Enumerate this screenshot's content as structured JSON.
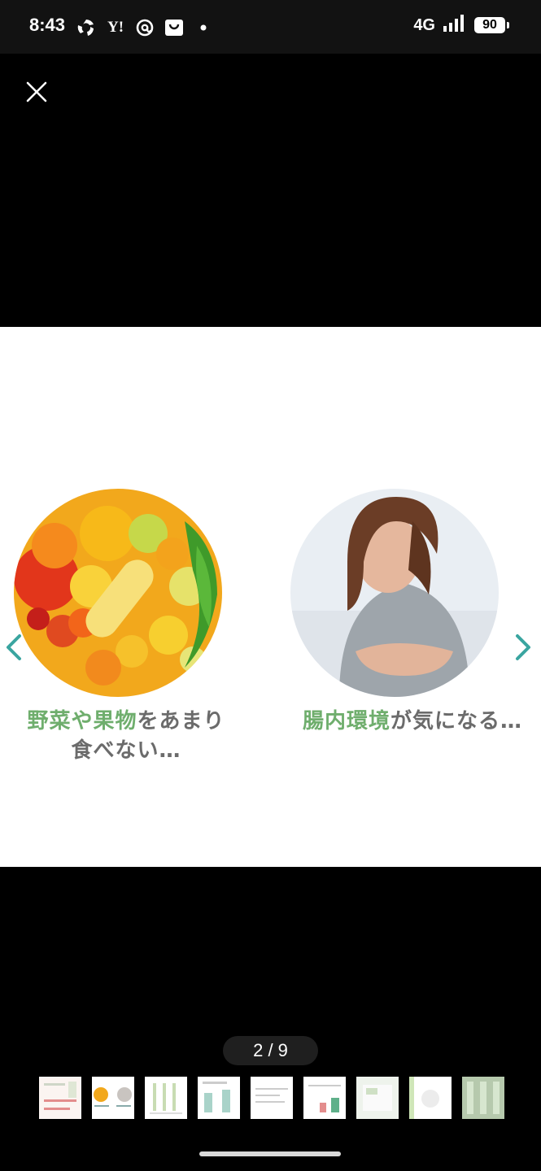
{
  "status_bar": {
    "time": "8:43",
    "icons": [
      "sync-icon",
      "yahoo-icon",
      "threads-icon",
      "shopping-bag-icon",
      "dot-icon"
    ],
    "yahoo_label": "Y!",
    "network": "4G",
    "battery": "90"
  },
  "viewer": {
    "close_icon": "close-icon",
    "counter": "2 / 9",
    "current_index": 2,
    "total": 9
  },
  "slide": {
    "left_caption_green": "野菜や果物",
    "left_caption_rest_line1": "をあまり",
    "left_caption_line2": "食べない…",
    "right_caption_green": "腸内環境",
    "right_caption_rest": "が気になる…",
    "accent_green": "#6fae6d",
    "arrow_color": "#3aa5a0"
  },
  "thumbnails": [
    {
      "name": "thumb-1",
      "active": false
    },
    {
      "name": "thumb-2",
      "active": true
    },
    {
      "name": "thumb-3",
      "active": false
    },
    {
      "name": "thumb-4",
      "active": false
    },
    {
      "name": "thumb-5",
      "active": false
    },
    {
      "name": "thumb-6",
      "active": false
    },
    {
      "name": "thumb-7",
      "active": false
    },
    {
      "name": "thumb-8",
      "active": false
    },
    {
      "name": "thumb-9",
      "active": false
    }
  ]
}
